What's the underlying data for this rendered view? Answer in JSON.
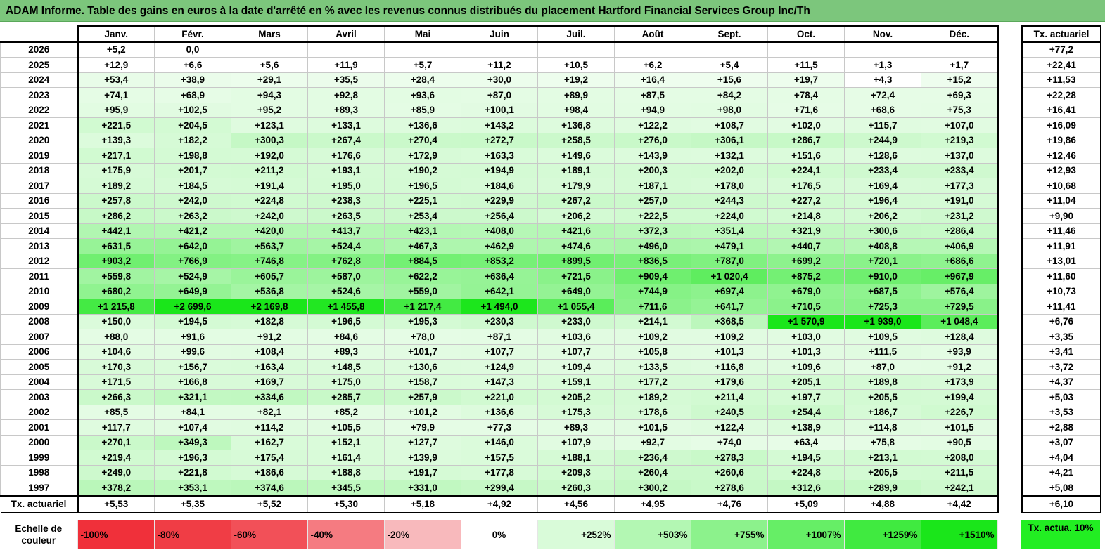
{
  "title": "ADAM Informe. Table des gains en euros à la date d'arrêté en % avec les revenus connus distribués du placement Hartford Financial Services Group Inc/Th",
  "months": [
    "Janv.",
    "Févr.",
    "Mars",
    "Avril",
    "Mai",
    "Juin",
    "Juil.",
    "Août",
    "Sept.",
    "Oct.",
    "Nov.",
    "Déc."
  ],
  "actuarial_header": "Tx. actuariel",
  "rows": [
    {
      "year": "2026",
      "values": [
        "+5,2",
        "0,0",
        "",
        "",
        "",
        "",
        "",
        "",
        "",
        "",
        "",
        ""
      ],
      "actuarial": "+77,2"
    },
    {
      "year": "2025",
      "values": [
        "+12,9",
        "+6,6",
        "+5,6",
        "+11,9",
        "+5,7",
        "+11,2",
        "+10,5",
        "+6,2",
        "+5,4",
        "+11,5",
        "+1,3",
        "+1,7"
      ],
      "actuarial": "+22,41"
    },
    {
      "year": "2024",
      "values": [
        "+53,4",
        "+38,9",
        "+29,1",
        "+35,5",
        "+28,4",
        "+30,0",
        "+19,2",
        "+16,4",
        "+15,6",
        "+19,7",
        "+4,3",
        "+15,2"
      ],
      "actuarial": "+11,53"
    },
    {
      "year": "2023",
      "values": [
        "+74,1",
        "+68,9",
        "+94,3",
        "+92,8",
        "+93,6",
        "+87,0",
        "+89,9",
        "+87,5",
        "+84,2",
        "+78,4",
        "+72,4",
        "+69,3"
      ],
      "actuarial": "+22,28"
    },
    {
      "year": "2022",
      "values": [
        "+95,9",
        "+102,5",
        "+95,2",
        "+89,3",
        "+85,9",
        "+100,1",
        "+98,4",
        "+94,9",
        "+98,0",
        "+71,6",
        "+68,6",
        "+75,3"
      ],
      "actuarial": "+16,41"
    },
    {
      "year": "2021",
      "values": [
        "+221,5",
        "+204,5",
        "+123,1",
        "+133,1",
        "+136,6",
        "+143,2",
        "+136,8",
        "+122,2",
        "+108,7",
        "+102,0",
        "+115,7",
        "+107,0"
      ],
      "actuarial": "+16,09"
    },
    {
      "year": "2020",
      "values": [
        "+139,3",
        "+182,2",
        "+300,3",
        "+267,4",
        "+270,4",
        "+272,7",
        "+258,5",
        "+276,0",
        "+306,1",
        "+286,7",
        "+244,9",
        "+219,3"
      ],
      "actuarial": "+19,86"
    },
    {
      "year": "2019",
      "values": [
        "+217,1",
        "+198,8",
        "+192,0",
        "+176,6",
        "+172,9",
        "+163,3",
        "+149,6",
        "+143,9",
        "+132,1",
        "+151,6",
        "+128,6",
        "+137,0"
      ],
      "actuarial": "+12,46"
    },
    {
      "year": "2018",
      "values": [
        "+175,9",
        "+201,7",
        "+211,2",
        "+193,1",
        "+190,2",
        "+194,9",
        "+189,1",
        "+200,3",
        "+202,0",
        "+224,1",
        "+233,4",
        "+233,4"
      ],
      "actuarial": "+12,93"
    },
    {
      "year": "2017",
      "values": [
        "+189,2",
        "+184,5",
        "+191,4",
        "+195,0",
        "+196,5",
        "+184,6",
        "+179,9",
        "+187,1",
        "+178,0",
        "+176,5",
        "+169,4",
        "+177,3"
      ],
      "actuarial": "+10,68"
    },
    {
      "year": "2016",
      "values": [
        "+257,8",
        "+242,0",
        "+224,8",
        "+238,3",
        "+225,1",
        "+229,9",
        "+267,2",
        "+257,0",
        "+244,3",
        "+227,2",
        "+196,4",
        "+191,0"
      ],
      "actuarial": "+11,04"
    },
    {
      "year": "2015",
      "values": [
        "+286,2",
        "+263,2",
        "+242,0",
        "+263,5",
        "+253,4",
        "+256,4",
        "+206,2",
        "+222,5",
        "+224,0",
        "+214,8",
        "+206,2",
        "+231,2"
      ],
      "actuarial": "+9,90"
    },
    {
      "year": "2014",
      "values": [
        "+442,1",
        "+421,2",
        "+420,0",
        "+413,7",
        "+423,1",
        "+408,0",
        "+421,6",
        "+372,3",
        "+351,4",
        "+321,9",
        "+300,6",
        "+286,4"
      ],
      "actuarial": "+11,46"
    },
    {
      "year": "2013",
      "values": [
        "+631,5",
        "+642,0",
        "+563,7",
        "+524,4",
        "+467,3",
        "+462,9",
        "+474,6",
        "+496,0",
        "+479,1",
        "+440,7",
        "+408,8",
        "+406,9"
      ],
      "actuarial": "+11,91"
    },
    {
      "year": "2012",
      "values": [
        "+903,2",
        "+766,9",
        "+746,8",
        "+762,8",
        "+884,5",
        "+853,2",
        "+899,5",
        "+836,5",
        "+787,0",
        "+699,2",
        "+720,1",
        "+686,6"
      ],
      "actuarial": "+13,01"
    },
    {
      "year": "2011",
      "values": [
        "+559,8",
        "+524,9",
        "+605,7",
        "+587,0",
        "+622,2",
        "+636,4",
        "+721,5",
        "+909,4",
        "+1 020,4",
        "+875,2",
        "+910,0",
        "+967,9"
      ],
      "actuarial": "+11,60"
    },
    {
      "year": "2010",
      "values": [
        "+680,2",
        "+649,9",
        "+536,8",
        "+524,6",
        "+559,0",
        "+642,1",
        "+649,0",
        "+744,9",
        "+697,4",
        "+679,0",
        "+687,5",
        "+576,4"
      ],
      "actuarial": "+10,73"
    },
    {
      "year": "2009",
      "values": [
        "+1 215,8",
        "+2 699,6",
        "+2 169,8",
        "+1 455,8",
        "+1 217,4",
        "+1 494,0",
        "+1 055,4",
        "+711,6",
        "+641,7",
        "+710,5",
        "+725,3",
        "+729,5"
      ],
      "actuarial": "+11,41"
    },
    {
      "year": "2008",
      "values": [
        "+150,0",
        "+194,5",
        "+182,8",
        "+196,5",
        "+195,3",
        "+230,3",
        "+233,0",
        "+214,1",
        "+368,5",
        "+1 570,9",
        "+1 939,0",
        "+1 048,4"
      ],
      "actuarial": "+6,76"
    },
    {
      "year": "2007",
      "values": [
        "+88,0",
        "+91,6",
        "+91,2",
        "+84,6",
        "+78,0",
        "+87,1",
        "+103,6",
        "+109,2",
        "+109,2",
        "+103,0",
        "+109,5",
        "+128,4"
      ],
      "actuarial": "+3,35"
    },
    {
      "year": "2006",
      "values": [
        "+104,6",
        "+99,6",
        "+108,4",
        "+89,3",
        "+101,7",
        "+107,7",
        "+107,7",
        "+105,8",
        "+101,3",
        "+101,3",
        "+111,5",
        "+93,9"
      ],
      "actuarial": "+3,41"
    },
    {
      "year": "2005",
      "values": [
        "+170,3",
        "+156,7",
        "+163,4",
        "+148,5",
        "+130,6",
        "+124,9",
        "+109,4",
        "+133,5",
        "+116,8",
        "+109,6",
        "+87,0",
        "+91,2"
      ],
      "actuarial": "+3,72"
    },
    {
      "year": "2004",
      "values": [
        "+171,5",
        "+166,8",
        "+169,7",
        "+175,0",
        "+158,7",
        "+147,3",
        "+159,1",
        "+177,2",
        "+179,6",
        "+205,1",
        "+189,8",
        "+173,9"
      ],
      "actuarial": "+4,37"
    },
    {
      "year": "2003",
      "values": [
        "+266,3",
        "+321,1",
        "+334,6",
        "+285,7",
        "+257,9",
        "+221,0",
        "+205,2",
        "+189,2",
        "+211,4",
        "+197,7",
        "+205,5",
        "+199,4"
      ],
      "actuarial": "+5,03"
    },
    {
      "year": "2002",
      "values": [
        "+85,5",
        "+84,1",
        "+82,1",
        "+85,2",
        "+101,2",
        "+136,6",
        "+175,3",
        "+178,6",
        "+240,5",
        "+254,4",
        "+186,7",
        "+226,7"
      ],
      "actuarial": "+3,53"
    },
    {
      "year": "2001",
      "values": [
        "+117,7",
        "+107,4",
        "+114,2",
        "+105,5",
        "+79,9",
        "+77,3",
        "+89,3",
        "+101,5",
        "+122,4",
        "+138,9",
        "+114,8",
        "+101,5"
      ],
      "actuarial": "+2,88"
    },
    {
      "year": "2000",
      "values": [
        "+270,1",
        "+349,3",
        "+162,7",
        "+152,1",
        "+127,7",
        "+146,0",
        "+107,9",
        "+92,7",
        "+74,0",
        "+63,4",
        "+75,8",
        "+90,5"
      ],
      "actuarial": "+3,07"
    },
    {
      "year": "1999",
      "values": [
        "+219,4",
        "+196,3",
        "+175,4",
        "+161,4",
        "+139,9",
        "+157,5",
        "+188,1",
        "+236,4",
        "+278,3",
        "+194,5",
        "+213,1",
        "+208,0"
      ],
      "actuarial": "+4,04"
    },
    {
      "year": "1998",
      "values": [
        "+249,0",
        "+221,8",
        "+186,6",
        "+188,8",
        "+191,7",
        "+177,8",
        "+209,3",
        "+260,4",
        "+260,6",
        "+224,8",
        "+205,5",
        "+211,5"
      ],
      "actuarial": "+4,21"
    },
    {
      "year": "1997",
      "values": [
        "+378,2",
        "+353,1",
        "+374,6",
        "+345,5",
        "+331,0",
        "+299,4",
        "+260,3",
        "+300,2",
        "+278,6",
        "+312,6",
        "+289,9",
        "+242,1"
      ],
      "actuarial": "+5,08"
    }
  ],
  "footer": {
    "label": "Tx. actuariel",
    "values": [
      "+5,53",
      "+5,35",
      "+5,52",
      "+5,30",
      "+5,18",
      "+4,92",
      "+4,56",
      "+4,95",
      "+4,76",
      "+5,09",
      "+4,88",
      "+4,42"
    ],
    "actuarial": "+6,10"
  },
  "scale": {
    "label": "Echelle de couleur",
    "items": [
      {
        "text": "-100%",
        "color": "#f0303a",
        "align": "neg"
      },
      {
        "text": "-80%",
        "color": "#f03d45",
        "align": "neg"
      },
      {
        "text": "-60%",
        "color": "#f25058",
        "align": "neg"
      },
      {
        "text": "-40%",
        "color": "#f57b81",
        "align": "neg"
      },
      {
        "text": "-20%",
        "color": "#f8b9bc",
        "align": "neg"
      },
      {
        "text": "0%",
        "color": "#ffffff",
        "align": "zero"
      },
      {
        "text": "+252%",
        "color": "#d9fbd9",
        "align": "pos"
      },
      {
        "text": "+503%",
        "color": "#b3f7b3",
        "align": "pos"
      },
      {
        "text": "+755%",
        "color": "#8cf28c",
        "align": "pos"
      },
      {
        "text": "+1007%",
        "color": "#66ee66",
        "align": "pos"
      },
      {
        "text": "+1259%",
        "color": "#40ea40",
        "align": "pos"
      },
      {
        "text": "+1510%",
        "color": "#1ae61a",
        "align": "pos"
      }
    ]
  },
  "legend_cell": {
    "text": "Tx. actua. 10%",
    "color": "#22ee22"
  }
}
